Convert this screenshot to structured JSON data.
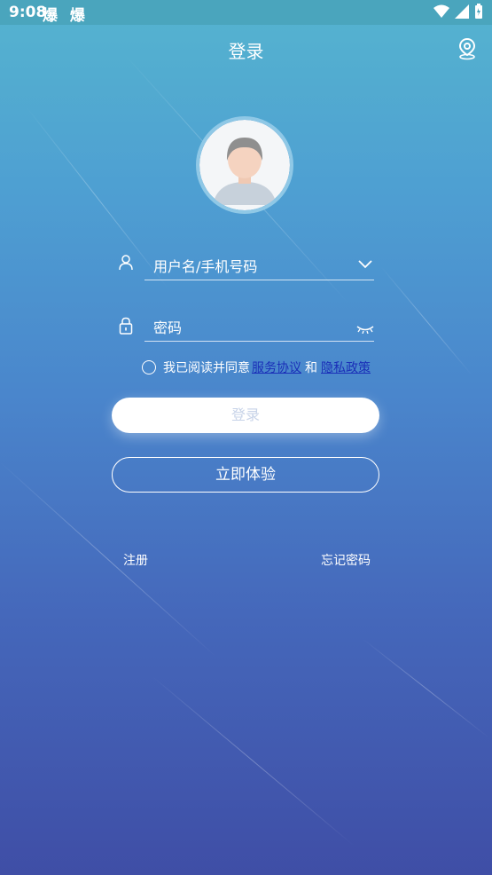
{
  "status_bar": {
    "time": "9:08",
    "notifications": "爆 爆"
  },
  "header": {
    "title": "登录",
    "location_icon": "location-pin-icon"
  },
  "form": {
    "username_placeholder": "用户名/手机号码",
    "password_placeholder": "密码"
  },
  "agreement": {
    "prefix": "我已阅读并同意",
    "service_link": "服务协议",
    "and": "和",
    "privacy_link": "隐私政策"
  },
  "buttons": {
    "login": "登录",
    "trial": "立即体验"
  },
  "footer": {
    "register": "注册",
    "forgot_password": "忘记密码"
  },
  "colors": {
    "link": "#1a2fb8",
    "gradient_top": "#55b4cf",
    "gradient_bottom": "#3f4ea6"
  }
}
